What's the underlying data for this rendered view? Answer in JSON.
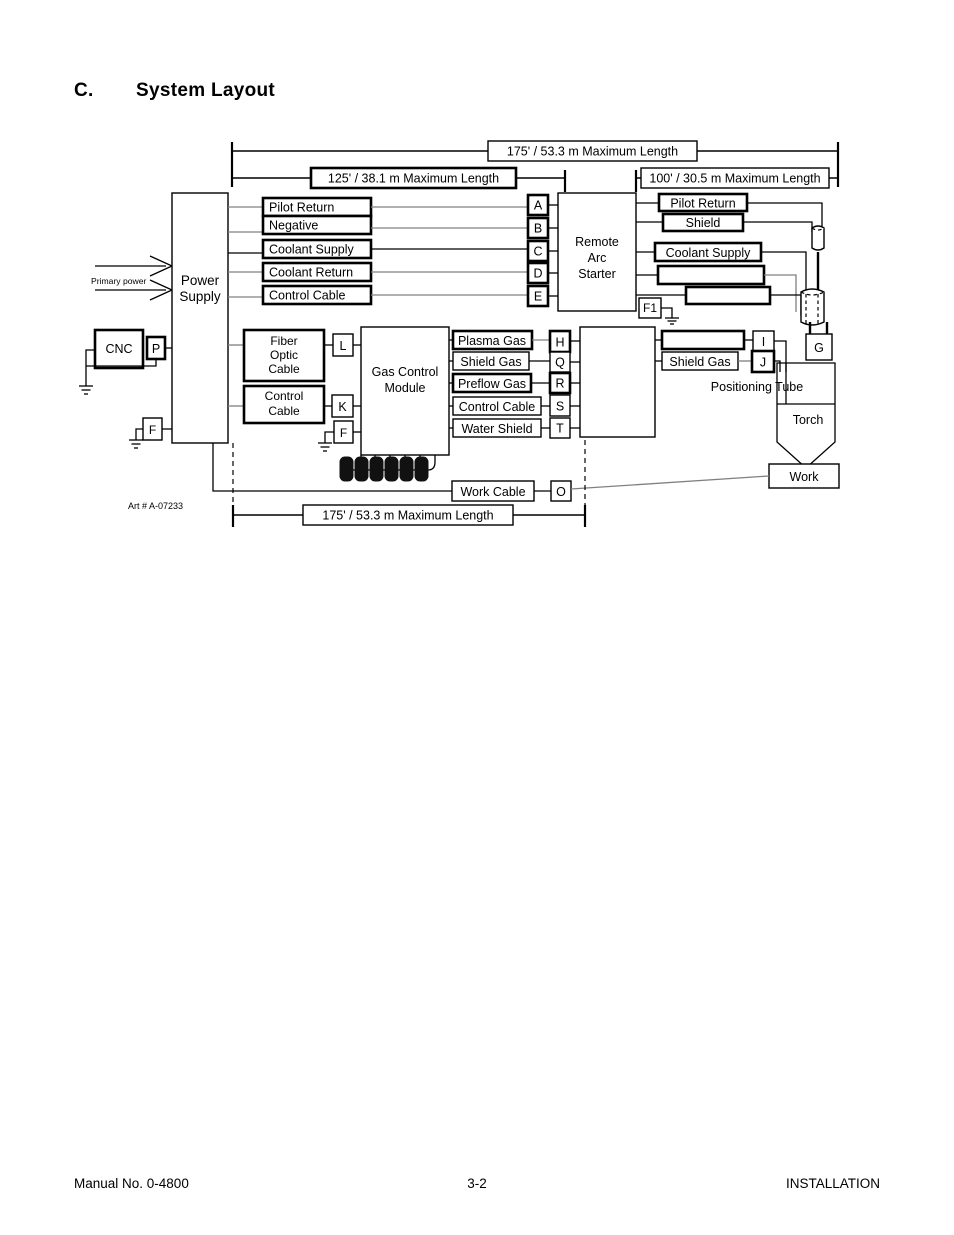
{
  "document": {
    "section_letter": "C.",
    "section_title": "System Layout",
    "art_number": "Art # A-07233"
  },
  "footer": {
    "manual": "Manual No. 0-4800",
    "page": "3-2",
    "chapter": "INSTALLATION"
  },
  "dimensions": {
    "top_overall": "175' / 53.3 m  Maximum Length",
    "top_left": "125' / 38.1 m   Maximum Length",
    "top_right": "100' / 30.5 m Maximum Length",
    "bottom": "175' /  53.3 m Maximum Length"
  },
  "blocks": {
    "power_supply_line1": "Power",
    "power_supply_line2": "Supply",
    "remote_arc_line1": "Remote",
    "remote_arc_line2": "Arc",
    "remote_arc_line3": "Starter",
    "gas_control_line1": "Gas Control",
    "gas_control_line2": "Module",
    "cnc": "CNC",
    "work": "Work",
    "torch": "Torch",
    "positioning_tube": "Positioning Tube",
    "primary_power": "Primary power"
  },
  "cables_left": [
    "Pilot Return",
    "Negative",
    "Coolant Supply",
    "Coolant Return",
    "Control Cable"
  ],
  "cables_right": [
    "Pilot Return",
    "Shield",
    "Coolant Supply",
    "",
    ""
  ],
  "cables_gas": [
    "Plasma Gas",
    "Shield Gas",
    "Preflow Gas",
    "Control Cable",
    "Water Shield"
  ],
  "cables_torch": [
    "",
    "Shield Gas"
  ],
  "cable_fiber_optic_line1": "Fiber",
  "cable_fiber_optic_line2": "Optic",
  "cable_fiber_optic_line3": "Cable",
  "cable_control_line1": "Control",
  "cable_control_line2": "Cable",
  "cable_work": "Work Cable",
  "connectors": {
    "ps_out": [
      "A",
      "B",
      "C",
      "D",
      "E"
    ],
    "gas_out": [
      "H",
      "Q",
      "R",
      "S",
      "T"
    ],
    "torch_in": [
      "I",
      "J"
    ],
    "fiber": "L",
    "control": "K",
    "cnc": "P",
    "ground_ps": "F",
    "ground_gcm": "F",
    "ground_ras": "F1",
    "work": "O",
    "torch_body": "G"
  },
  "colors": {
    "ink": "#000000",
    "line_gray": "#808080",
    "paper": "#ffffff"
  }
}
